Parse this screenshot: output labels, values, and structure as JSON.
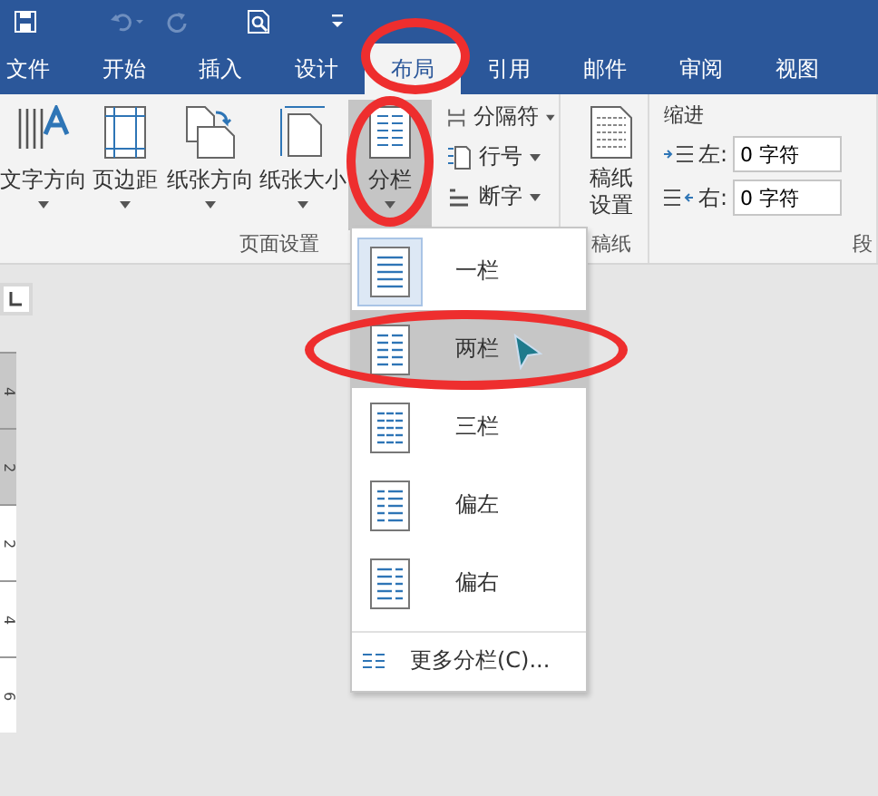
{
  "quick_access": [
    {
      "kind": "save",
      "disabled": false
    },
    {
      "kind": "undo",
      "disabled": true
    },
    {
      "kind": "redo",
      "disabled": true
    },
    {
      "kind": "preview",
      "disabled": false
    },
    {
      "kind": "customize",
      "disabled": false
    }
  ],
  "tabs": [
    {
      "label": "文件",
      "selected": false
    },
    {
      "label": "开始",
      "selected": false
    },
    {
      "label": "插入",
      "selected": false
    },
    {
      "label": "设计",
      "selected": false
    },
    {
      "label": "布局",
      "selected": true
    },
    {
      "label": "引用",
      "selected": false
    },
    {
      "label": "邮件",
      "selected": false
    },
    {
      "label": "审阅",
      "selected": false
    },
    {
      "label": "视图",
      "selected": false
    }
  ],
  "page_setup": {
    "label": "页面设置",
    "large_buttons": [
      {
        "label": "文字方向",
        "kind": "text-direction",
        "pressed": false
      },
      {
        "label": "页边距",
        "kind": "margins",
        "pressed": false
      },
      {
        "label": "纸张方向",
        "kind": "orientation",
        "pressed": false
      },
      {
        "label": "纸张大小",
        "kind": "size",
        "pressed": false
      },
      {
        "label": "分栏",
        "kind": "columns",
        "pressed": true
      }
    ],
    "small_buttons": [
      {
        "label": "分隔符",
        "kind": "breaks"
      },
      {
        "label": "行号",
        "kind": "line-numbers"
      },
      {
        "label": "断字",
        "kind": "hyphenation"
      }
    ]
  },
  "manuscript": {
    "label": "稿纸",
    "button": "稿纸设置"
  },
  "paragraph": {
    "indent_title": "缩进",
    "fields": [
      {
        "label": "左:",
        "value": "0 字符",
        "kind": "left"
      },
      {
        "label": "右:",
        "value": "0 字符",
        "kind": "right"
      }
    ],
    "group_label": "段"
  },
  "ruler": {
    "labels": [
      {
        "text": "4",
        "margin": true
      },
      {
        "text": "2",
        "margin": true
      },
      {
        "text": "2",
        "margin": false
      },
      {
        "text": "4",
        "margin": false
      },
      {
        "text": "6",
        "margin": false
      }
    ]
  },
  "columns_menu": {
    "items": [
      {
        "label": "一栏",
        "kind": "one",
        "selected": true,
        "highlighted": false
      },
      {
        "label": "两栏",
        "kind": "two",
        "selected": false,
        "highlighted": true
      },
      {
        "label": "三栏",
        "kind": "three",
        "selected": false,
        "highlighted": false
      },
      {
        "label": "偏左",
        "kind": "left",
        "selected": false,
        "highlighted": false
      },
      {
        "label": "偏右",
        "kind": "right",
        "selected": false,
        "highlighted": false
      }
    ],
    "more": "更多分栏(C)..."
  },
  "annotations": [
    {
      "kind": "tab"
    },
    {
      "kind": "button"
    },
    {
      "kind": "menu-item"
    }
  ]
}
